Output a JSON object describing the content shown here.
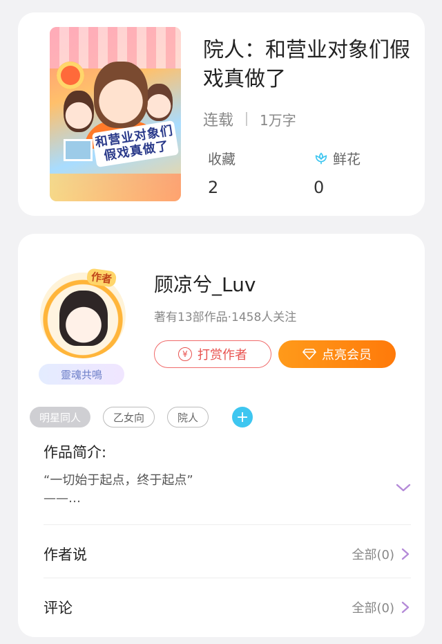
{
  "book": {
    "cover_title_art": "和营业对象们假戏真做了",
    "title": "院人：和营业对象们假戏真做了",
    "status": "连载",
    "word_count": "1万字",
    "favorites_label": "收藏",
    "favorites_value": "2",
    "flowers_label": "鲜花",
    "flowers_value": "0"
  },
  "author": {
    "badge": "作者",
    "tag": "靈魂共鳴",
    "name": "顾凉兮_Luv",
    "stats": "著有13部作品·1458人关注",
    "tip_button": "打赏作者",
    "vip_button": "点亮会员"
  },
  "tags": [
    "明星同人",
    "乙女向",
    "院人"
  ],
  "intro": {
    "title": "作品简介:",
    "text": "“一切始于起点，终于起点”\n——…"
  },
  "rows": [
    {
      "label": "作者说",
      "value": "全部(0)"
    },
    {
      "label": "评论",
      "value": "全部(0)"
    }
  ],
  "colors": {
    "accent_orange": "#ff8a12",
    "tip_red": "#e8524f",
    "chevron_purple": "#b48ad8",
    "add_blue": "#3ec6f0"
  },
  "icons": {
    "flower": "flower-icon",
    "yen": "yen-icon",
    "gem": "gem-icon",
    "plus": "plus-icon",
    "expand": "chevron-down-icon",
    "arrow": "chevron-right-icon"
  }
}
